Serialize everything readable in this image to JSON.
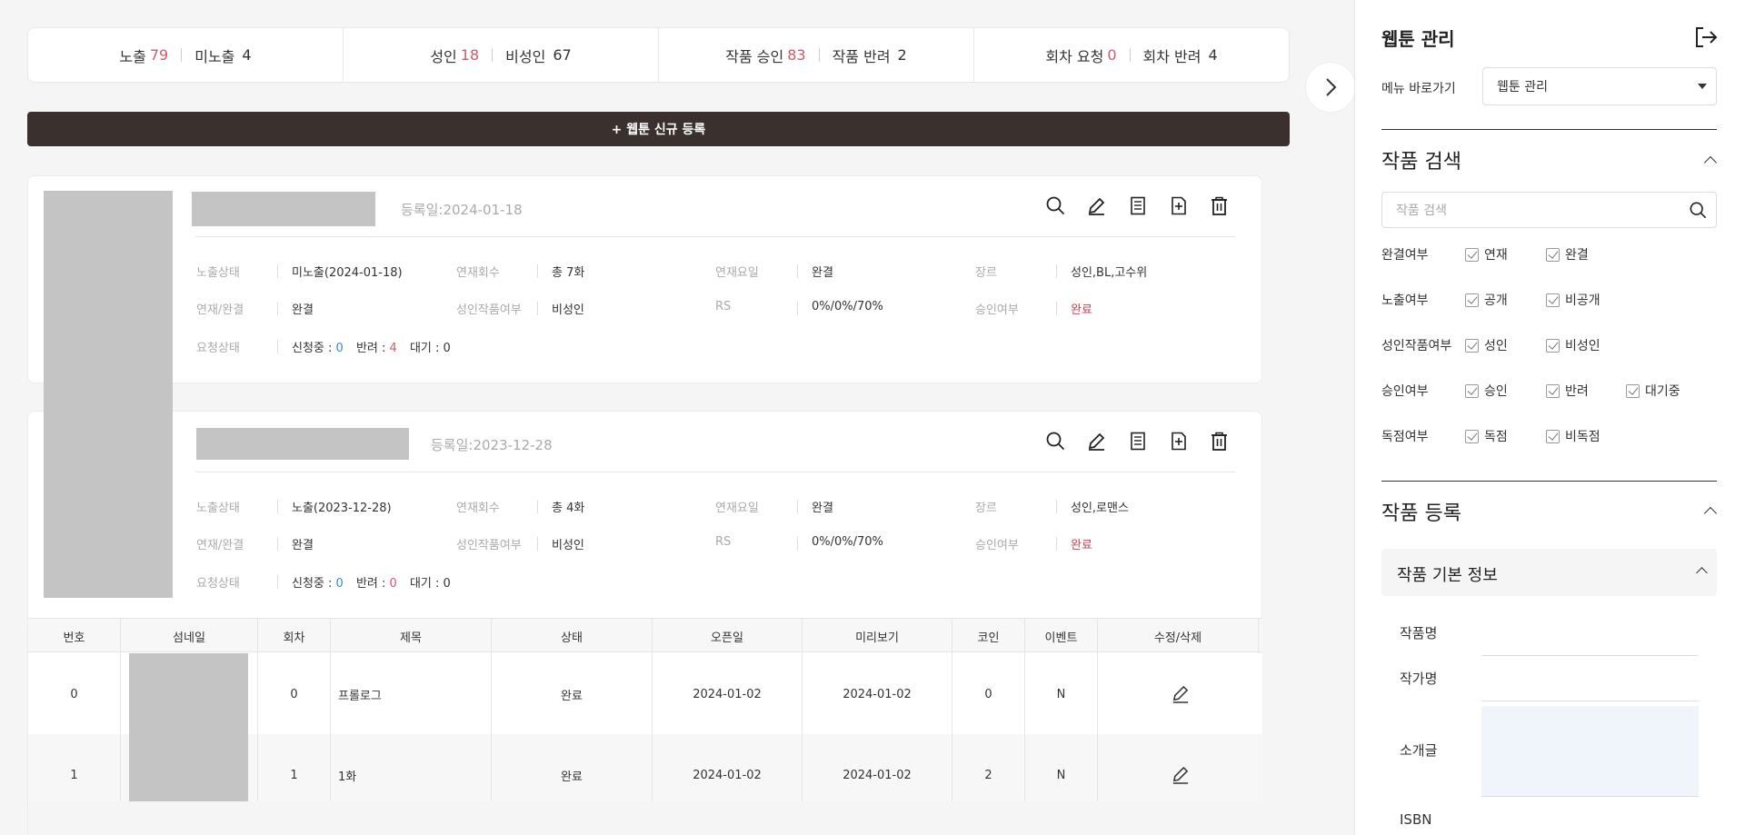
{
  "stats": [
    {
      "items": [
        {
          "label": "노출",
          "value": "79",
          "red": true
        },
        {
          "label": "미노출",
          "value": "4",
          "red": false
        }
      ]
    },
    {
      "items": [
        {
          "label": "성인",
          "value": "18",
          "red": true
        },
        {
          "label": "비성인",
          "value": "67",
          "red": false
        }
      ]
    },
    {
      "items": [
        {
          "label": "작품 승인",
          "value": "83",
          "red": true
        },
        {
          "label": "작품 반려",
          "value": "2",
          "red": false
        }
      ]
    },
    {
      "items": [
        {
          "label": "회차 요청",
          "value": "0",
          "red": true
        },
        {
          "label": "회차 반려",
          "value": "4",
          "red": false
        }
      ]
    }
  ],
  "register_button": "+ 웹툰 신규 등록",
  "labels": {
    "expose": "노출상태",
    "episodes": "연재회수",
    "days": "연재요일",
    "genre": "장르",
    "serial": "연재/완결",
    "adult": "성인작품여부",
    "rs": "RS",
    "approve": "승인여부",
    "request": "요청상태",
    "applying": "신청중 : ",
    "rejected": "반려 : ",
    "waiting": "대기 : "
  },
  "cards": [
    {
      "reg_date": "등록일:2024-01-18",
      "expose": "미노출(2024-01-18)",
      "episodes": "총 7화",
      "days": "완결",
      "genre": "성인,BL,고수위",
      "serial": "완결",
      "adult": "비성인",
      "rs": "0%/0%/70%",
      "approve": "완료",
      "applying": "0",
      "rejected": "4",
      "waiting": "0"
    },
    {
      "reg_date": "등록일:2023-12-28",
      "expose": "노출(2023-12-28)",
      "episodes": "총 4화",
      "days": "완결",
      "genre": "성인,로맨스",
      "serial": "완결",
      "adult": "비성인",
      "rs": "0%/0%/70%",
      "approve": "완료",
      "applying": "0",
      "rejected": "0",
      "waiting": "0"
    }
  ],
  "table": {
    "headers": [
      "번호",
      "섬네일",
      "회차",
      "제목",
      "상태",
      "오픈일",
      "미리보기",
      "코인",
      "이벤트",
      "수정/삭제"
    ],
    "rows": [
      {
        "no": "0",
        "ep": "0",
        "title": "프롤로그",
        "status": "완료",
        "open": "2024-01-02",
        "preview": "2024-01-02",
        "coin": "0",
        "event": "N"
      },
      {
        "no": "1",
        "ep": "1",
        "title": "1화",
        "status": "완료",
        "open": "2024-01-02",
        "preview": "2024-01-02",
        "coin": "2",
        "event": "N"
      }
    ]
  },
  "panel": {
    "title": "웹툰 관리",
    "menu_label": "메뉴 바로가기",
    "menu_value": "웹툰 관리",
    "search_title": "작품 검색",
    "search_placeholder": "작품 검색",
    "filters": [
      {
        "label": "완결여부",
        "options": [
          "연재",
          "완결"
        ]
      },
      {
        "label": "노출여부",
        "options": [
          "공개",
          "비공개"
        ]
      },
      {
        "label": "성인작품여부",
        "options": [
          "성인",
          "비성인"
        ]
      },
      {
        "label": "승인여부",
        "options": [
          "승인",
          "반려",
          "대기중"
        ]
      },
      {
        "label": "독점여부",
        "options": [
          "독점",
          "비독점"
        ]
      }
    ],
    "register_title": "작품 등록",
    "basic_info": "작품 기본 정보",
    "form_labels": [
      "작품명",
      "작가명",
      "소개글",
      "ISBN"
    ]
  }
}
